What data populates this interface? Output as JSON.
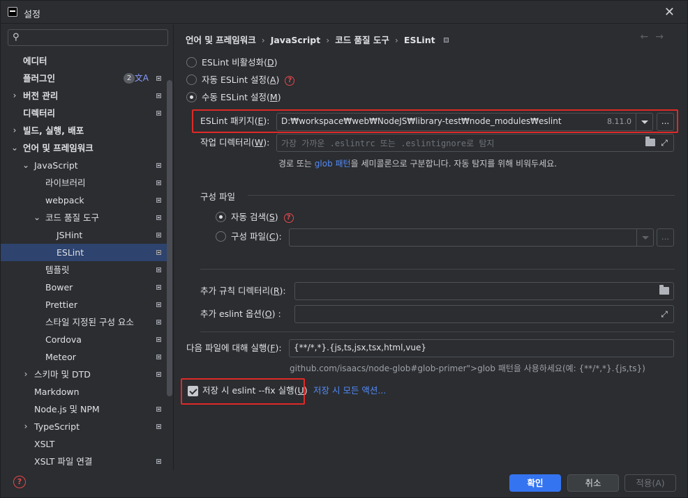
{
  "window": {
    "title": "설정"
  },
  "search": {
    "placeholder": ""
  },
  "sidebar": {
    "items": [
      {
        "label": "에디터",
        "bold": true
      },
      {
        "label": "플러그인",
        "bold": true,
        "badge": "2"
      },
      {
        "label": "버전 관리",
        "bold": true
      },
      {
        "label": "디렉터리",
        "bold": true
      },
      {
        "label": "빌드, 실행, 배포",
        "bold": true
      },
      {
        "label": "언어 및 프레임워크",
        "bold": true
      },
      {
        "label": "JavaScript"
      },
      {
        "label": "라이브러리"
      },
      {
        "label": "webpack"
      },
      {
        "label": "코드 품질 도구"
      },
      {
        "label": "JSHint"
      },
      {
        "label": "ESLint"
      },
      {
        "label": "템플릿"
      },
      {
        "label": "Bower"
      },
      {
        "label": "Prettier"
      },
      {
        "label": "스타일 지정된 구성 요소"
      },
      {
        "label": "Cordova"
      },
      {
        "label": "Meteor"
      },
      {
        "label": "스키마 및 DTD"
      },
      {
        "label": "Markdown"
      },
      {
        "label": "Node.js 및 NPM"
      },
      {
        "label": "TypeScript"
      },
      {
        "label": "XSLT"
      },
      {
        "label": "XSLT 파일 연결"
      }
    ]
  },
  "breadcrumb": [
    "언어 및 프레임워크",
    "JavaScript",
    "코드 품질 도구",
    "ESLint"
  ],
  "mode": {
    "disable": {
      "text": "ESLint 비활성화(",
      "key": "D",
      "end": ")"
    },
    "auto": {
      "text": "자동 ESLint 설정(",
      "key": "A",
      "end": ")"
    },
    "manual": {
      "text": "수동 ESLint 설정(",
      "key": "M",
      "end": ")"
    }
  },
  "package": {
    "label_text": "ESLint 패키지(",
    "label_key": "E",
    "label_end": "):",
    "value": "D:₩workspace₩web₩NodeJS₩library-test₩node_modules₩eslint",
    "version": "8.11.0",
    "browse": "..."
  },
  "workdir": {
    "label_text": "작업 디렉터리(",
    "label_key": "W",
    "label_end": "):",
    "placeholder": "가장 가까운 .eslintrc 또는 .eslintignore로 탐지"
  },
  "path_hint": {
    "pre": "경로 또는 ",
    "link": "glob 패턴",
    "post": "을 세미콜론으로 구분합니다. 자동 탐지를 위해 비워두세요."
  },
  "config": {
    "title": "구성 파일",
    "auto": {
      "text": "자동 검색(",
      "key": "S",
      "end": ")"
    },
    "file": {
      "text": "구성 파일(",
      "key": "C",
      "end": "):"
    },
    "browse": "..."
  },
  "extra_rules": {
    "label_text": "추가 규칙 디렉터리(",
    "label_key": "R",
    "label_end": "):"
  },
  "extra_options": {
    "label_text": "추가 eslint 옵션(",
    "label_key": "O",
    "label_end": ") :"
  },
  "run_for": {
    "label_text": "다음 파일에 대해 실행(",
    "label_key": "F",
    "label_end": "):",
    "value": "{**/*,*}.{js,ts,jsx,tsx,html,vue}"
  },
  "glob_hint": "github.com/isaacs/node-glob#glob-primer\">glob 패턴을 사용하세요(예: {**/*,*}.{js,ts})",
  "fix_on_save": {
    "text": "저장 시 eslint --fix 실행(",
    "key": "U",
    "end": ")",
    "link": "저장 시 모든 액션..."
  },
  "footer": {
    "ok": "확인",
    "cancel": "취소",
    "apply": "적용(A)"
  }
}
